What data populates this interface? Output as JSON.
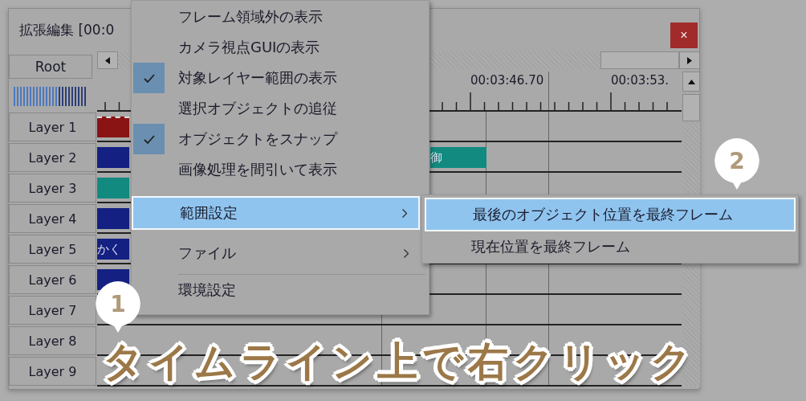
{
  "window": {
    "title": "拡張編集 [00:0",
    "close": "×"
  },
  "root_button": "Root",
  "ruler": {
    "labels": [
      "00:03:46.70",
      "00:03:53."
    ]
  },
  "layers": [
    {
      "label": "Layer 1",
      "clips": [
        {
          "kind": "head",
          "color": "#8a1414"
        }
      ]
    },
    {
      "label": "Layer 2",
      "clips": [
        {
          "kind": "head",
          "color": "#142082"
        },
        {
          "kind": "mid",
          "color": "#128a80",
          "text": "御"
        }
      ]
    },
    {
      "label": "Layer 3",
      "clips": [
        {
          "kind": "head",
          "color": "#128a80"
        }
      ]
    },
    {
      "label": "Layer 4",
      "clips": [
        {
          "kind": "head",
          "color": "#142082"
        }
      ]
    },
    {
      "label": "Layer 5",
      "clips": [
        {
          "kind": "head",
          "color": "#142082",
          "text": "かく"
        }
      ]
    },
    {
      "label": "Layer 6",
      "clips": [
        {
          "kind": "head",
          "color": "#142082"
        }
      ]
    },
    {
      "label": "Layer 7"
    },
    {
      "label": "Layer 8"
    },
    {
      "label": "Layer 9"
    }
  ],
  "context_menu": {
    "items": [
      {
        "kind": "item",
        "label": "フレーム領域外の表示",
        "checked": false,
        "selected": false
      },
      {
        "kind": "item",
        "label": "カメラ視点GUIの表示",
        "checked": false,
        "selected": false
      },
      {
        "kind": "item",
        "label": "対象レイヤー範囲の表示",
        "checked": true,
        "selected": false
      },
      {
        "kind": "item",
        "label": "選択オブジェクトの追従",
        "checked": false,
        "selected": false
      },
      {
        "kind": "item",
        "label": "オブジェクトをスナップ",
        "checked": true,
        "selected": false
      },
      {
        "kind": "item",
        "label": "画像処理を間引いて表示",
        "checked": false,
        "selected": false
      },
      {
        "kind": "submenu",
        "label": "範囲設定",
        "checked": false,
        "selected": true
      },
      {
        "kind": "submenu",
        "label": "ファイル",
        "checked": false,
        "selected": false
      },
      {
        "kind": "separator"
      },
      {
        "kind": "item",
        "label": "環境設定",
        "checked": false,
        "selected": false
      }
    ]
  },
  "submenu": {
    "items": [
      {
        "label": "最後のオブジェクト位置を最終フレーム",
        "selected": true
      },
      {
        "label": "現在位置を最終フレーム",
        "selected": false
      }
    ]
  },
  "callouts": [
    {
      "number": "1"
    },
    {
      "number": "2"
    }
  ],
  "caption": "タイムライン上で右クリック"
}
